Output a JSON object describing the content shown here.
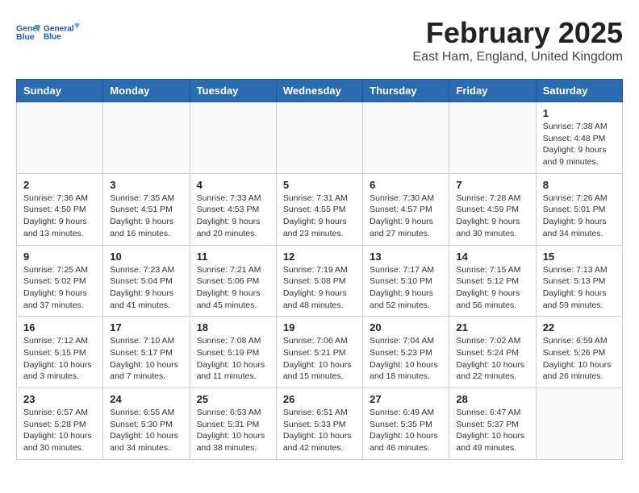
{
  "header": {
    "logo_line1": "General",
    "logo_line2": "Blue",
    "title": "February 2025",
    "subtitle": "East Ham, England, United Kingdom"
  },
  "days_of_week": [
    "Sunday",
    "Monday",
    "Tuesday",
    "Wednesday",
    "Thursday",
    "Friday",
    "Saturday"
  ],
  "weeks": [
    [
      {
        "day": "",
        "info": ""
      },
      {
        "day": "",
        "info": ""
      },
      {
        "day": "",
        "info": ""
      },
      {
        "day": "",
        "info": ""
      },
      {
        "day": "",
        "info": ""
      },
      {
        "day": "",
        "info": ""
      },
      {
        "day": "1",
        "info": "Sunrise: 7:38 AM\nSunset: 4:48 PM\nDaylight: 9 hours and 9 minutes."
      }
    ],
    [
      {
        "day": "2",
        "info": "Sunrise: 7:36 AM\nSunset: 4:50 PM\nDaylight: 9 hours and 13 minutes."
      },
      {
        "day": "3",
        "info": "Sunrise: 7:35 AM\nSunset: 4:51 PM\nDaylight: 9 hours and 16 minutes."
      },
      {
        "day": "4",
        "info": "Sunrise: 7:33 AM\nSunset: 4:53 PM\nDaylight: 9 hours and 20 minutes."
      },
      {
        "day": "5",
        "info": "Sunrise: 7:31 AM\nSunset: 4:55 PM\nDaylight: 9 hours and 23 minutes."
      },
      {
        "day": "6",
        "info": "Sunrise: 7:30 AM\nSunset: 4:57 PM\nDaylight: 9 hours and 27 minutes."
      },
      {
        "day": "7",
        "info": "Sunrise: 7:28 AM\nSunset: 4:59 PM\nDaylight: 9 hours and 30 minutes."
      },
      {
        "day": "8",
        "info": "Sunrise: 7:26 AM\nSunset: 5:01 PM\nDaylight: 9 hours and 34 minutes."
      }
    ],
    [
      {
        "day": "9",
        "info": "Sunrise: 7:25 AM\nSunset: 5:02 PM\nDaylight: 9 hours and 37 minutes."
      },
      {
        "day": "10",
        "info": "Sunrise: 7:23 AM\nSunset: 5:04 PM\nDaylight: 9 hours and 41 minutes."
      },
      {
        "day": "11",
        "info": "Sunrise: 7:21 AM\nSunset: 5:06 PM\nDaylight: 9 hours and 45 minutes."
      },
      {
        "day": "12",
        "info": "Sunrise: 7:19 AM\nSunset: 5:08 PM\nDaylight: 9 hours and 48 minutes."
      },
      {
        "day": "13",
        "info": "Sunrise: 7:17 AM\nSunset: 5:10 PM\nDaylight: 9 hours and 52 minutes."
      },
      {
        "day": "14",
        "info": "Sunrise: 7:15 AM\nSunset: 5:12 PM\nDaylight: 9 hours and 56 minutes."
      },
      {
        "day": "15",
        "info": "Sunrise: 7:13 AM\nSunset: 5:13 PM\nDaylight: 9 hours and 59 minutes."
      }
    ],
    [
      {
        "day": "16",
        "info": "Sunrise: 7:12 AM\nSunset: 5:15 PM\nDaylight: 10 hours and 3 minutes."
      },
      {
        "day": "17",
        "info": "Sunrise: 7:10 AM\nSunset: 5:17 PM\nDaylight: 10 hours and 7 minutes."
      },
      {
        "day": "18",
        "info": "Sunrise: 7:08 AM\nSunset: 5:19 PM\nDaylight: 10 hours and 11 minutes."
      },
      {
        "day": "19",
        "info": "Sunrise: 7:06 AM\nSunset: 5:21 PM\nDaylight: 10 hours and 15 minutes."
      },
      {
        "day": "20",
        "info": "Sunrise: 7:04 AM\nSunset: 5:23 PM\nDaylight: 10 hours and 18 minutes."
      },
      {
        "day": "21",
        "info": "Sunrise: 7:02 AM\nSunset: 5:24 PM\nDaylight: 10 hours and 22 minutes."
      },
      {
        "day": "22",
        "info": "Sunrise: 6:59 AM\nSunset: 5:26 PM\nDaylight: 10 hours and 26 minutes."
      }
    ],
    [
      {
        "day": "23",
        "info": "Sunrise: 6:57 AM\nSunset: 5:28 PM\nDaylight: 10 hours and 30 minutes."
      },
      {
        "day": "24",
        "info": "Sunrise: 6:55 AM\nSunset: 5:30 PM\nDaylight: 10 hours and 34 minutes."
      },
      {
        "day": "25",
        "info": "Sunrise: 6:53 AM\nSunset: 5:31 PM\nDaylight: 10 hours and 38 minutes."
      },
      {
        "day": "26",
        "info": "Sunrise: 6:51 AM\nSunset: 5:33 PM\nDaylight: 10 hours and 42 minutes."
      },
      {
        "day": "27",
        "info": "Sunrise: 6:49 AM\nSunset: 5:35 PM\nDaylight: 10 hours and 46 minutes."
      },
      {
        "day": "28",
        "info": "Sunrise: 6:47 AM\nSunset: 5:37 PM\nDaylight: 10 hours and 49 minutes."
      },
      {
        "day": "",
        "info": ""
      }
    ]
  ]
}
